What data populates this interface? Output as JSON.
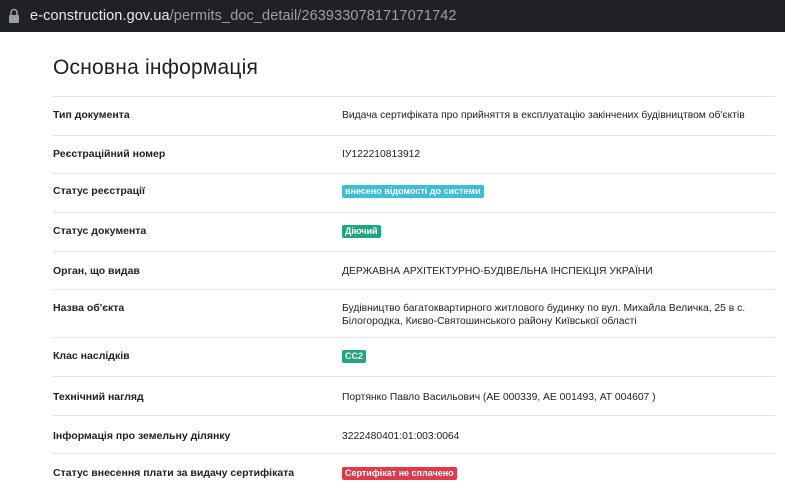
{
  "browser": {
    "url_host": "e-construction.gov.ua",
    "url_path": "/permits_doc_detail/2639330781717071742"
  },
  "page": {
    "title": "Основна інформація"
  },
  "rows": [
    {
      "label": "Тип документа",
      "value": "Видача сертифіката про прийняття в експлуатацію закінчених будівництвом об'єктів"
    },
    {
      "label": "Реєстраційний номер",
      "value": "ІУ122210813912"
    },
    {
      "label": "Статус реєстрації",
      "badge": "внесено відомості до системи",
      "badge_color": "#3bbfd8"
    },
    {
      "label": "Статус документа",
      "badge": "Діючий",
      "badge_color": "#21a77f"
    },
    {
      "label": "Орган, що видав",
      "value": "ДЕРЖАВНА АРХІТЕКТУРНО-БУДІВЕЛЬНА ІНСПЕКЦІЯ УКРАЇНИ"
    },
    {
      "label": "Назва об'єкта",
      "value": "Будівництво багатоквартирного житлового будинку по вул. Михайла Величка, 25 в с. Білогородка, Києво-Святошинського району Київської області"
    },
    {
      "label": "Клас наслідків",
      "badge": "СС2",
      "badge_color": "#21a77f"
    },
    {
      "label": "Технічний нагляд",
      "value": "Портянко Павло Васильович (АЕ 000339, АЕ 001493, АТ 004607 )"
    },
    {
      "label": "Інформація про земельну ділянку",
      "value": "3222480401:01:003:0064"
    },
    {
      "label": "Статус внесення плати за видачу сертифіката",
      "badge": "Сертифікат не сплачено",
      "badge_color": "#e0394a"
    }
  ]
}
